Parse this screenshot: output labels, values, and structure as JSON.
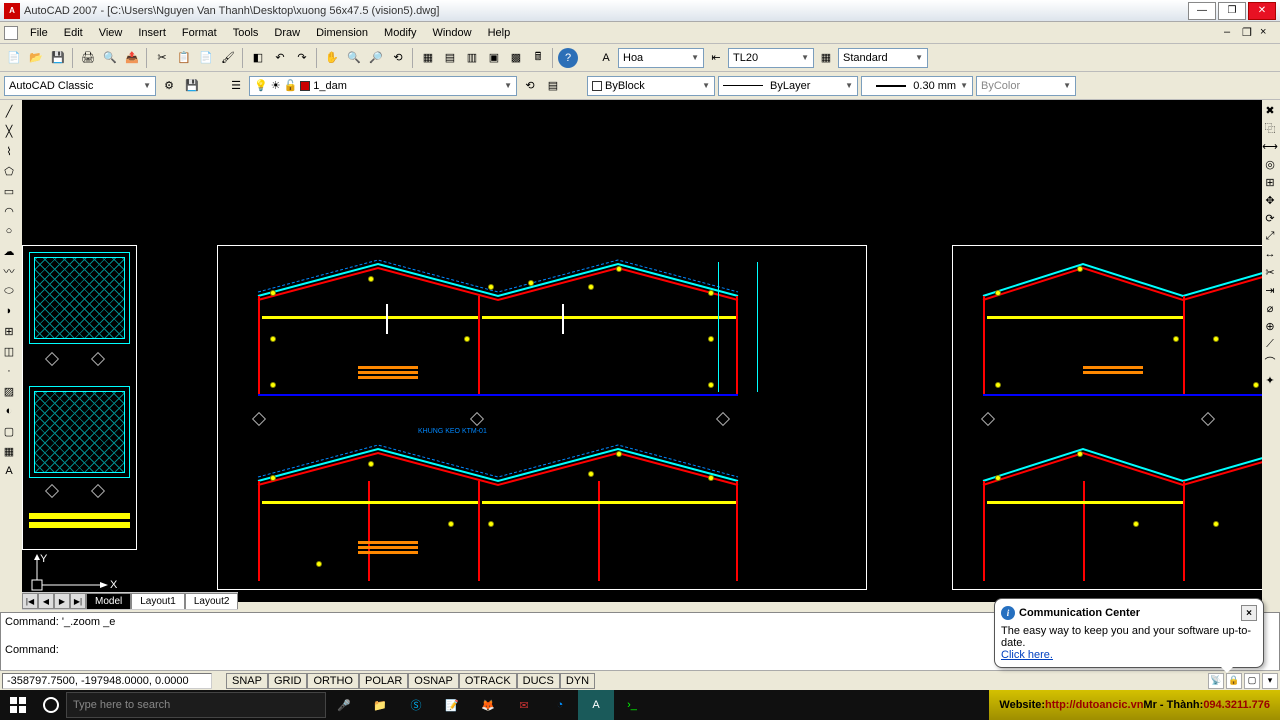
{
  "titlebar": {
    "app": "AutoCAD 2007",
    "file": "[C:\\Users\\Nguyen Van Thanh\\Desktop\\xuong 56x47.5 (vision5).dwg]"
  },
  "menu": [
    "File",
    "Edit",
    "View",
    "Insert",
    "Format",
    "Tools",
    "Draw",
    "Dimension",
    "Modify",
    "Window",
    "Help"
  ],
  "workspace_select": "AutoCAD Classic",
  "layer": {
    "current": "1_dam"
  },
  "props": {
    "textstyle": "Hoa",
    "dimstyle": "TL20",
    "tablestyle": "Standard",
    "color": "ByBlock",
    "linetype": "ByLayer",
    "lineweight": "0.30 mm",
    "plotstyle": "ByColor"
  },
  "tabs": {
    "nav": [
      "|◀",
      "◀",
      "▶",
      "▶|"
    ],
    "items": [
      "Model",
      "Layout1",
      "Layout2"
    ],
    "active": 0
  },
  "command": {
    "line1": "Command: '_.zoom _e",
    "line2": "Command:"
  },
  "status": {
    "coords": "-358797.7500, -197948.0000, 0.0000",
    "toggles": [
      "SNAP",
      "GRID",
      "ORTHO",
      "POLAR",
      "OSNAP",
      "OTRACK",
      "DUCS",
      "DYN"
    ]
  },
  "comm": {
    "title": "Communication Center",
    "body": "The easy way to keep you and your software up-to-date.",
    "link": "Click here."
  },
  "taskbar": {
    "search_placeholder": "Type here to search",
    "banner_label": "Website:",
    "banner_url": "http://dutoancic.vn",
    "banner_sep": " Mr - Thành: ",
    "banner_phone": "094.3211.776"
  },
  "canvas": {
    "label1": "KHUNG KEO KTM-01"
  }
}
